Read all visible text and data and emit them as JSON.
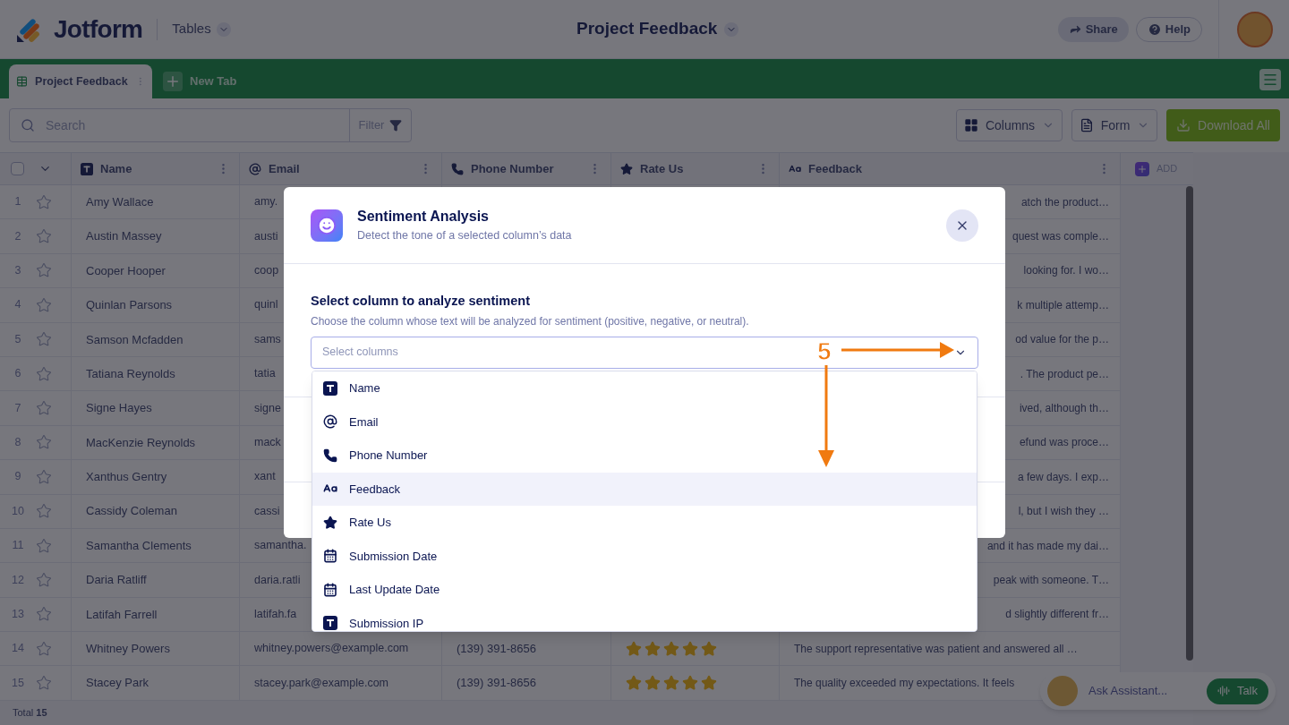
{
  "header": {
    "logo": "Jotform",
    "section": "Tables",
    "title": "Project Feedback",
    "share": "Share",
    "help": "Help"
  },
  "tabs": [
    {
      "label": "Project Feedback",
      "selected": true
    }
  ],
  "new_tab": "New Tab",
  "toolbar": {
    "search_placeholder": "Search",
    "filter": "Filter",
    "columns": "Columns",
    "form": "Form",
    "download": "Download All"
  },
  "table": {
    "columns": [
      {
        "label": "Name",
        "kind": "text"
      },
      {
        "label": "Email",
        "kind": "email"
      },
      {
        "label": "Phone Number",
        "kind": "phone"
      },
      {
        "label": "Rate Us",
        "kind": "rating"
      },
      {
        "label": "Feedback",
        "kind": "longtext"
      }
    ],
    "add": "ADD",
    "select_all_checked": false,
    "rows": [
      {
        "index": "1",
        "starred": false,
        "name": "Amy Wallace",
        "email": "amy.",
        "feedback": "atch the product…"
      },
      {
        "index": "2",
        "starred": false,
        "name": "Austin Massey",
        "email": "austi",
        "feedback": "quest was comple…"
      },
      {
        "index": "3",
        "starred": false,
        "name": "Cooper Hooper",
        "email": "coop",
        "feedback": "looking for. I wo…"
      },
      {
        "index": "4",
        "starred": false,
        "name": "Quinlan Parsons",
        "email": "quinl",
        "feedback": "k multiple attemp…"
      },
      {
        "index": "5",
        "starred": false,
        "name": "Samson Mcfadden",
        "email": "sams",
        "feedback": "od value for the p…"
      },
      {
        "index": "6",
        "starred": false,
        "name": "Tatiana Reynolds",
        "email": "tatia",
        "feedback": ". The product pe…"
      },
      {
        "index": "7",
        "starred": false,
        "name": "Signe Hayes",
        "email": "signe",
        "feedback": "ived, although th…"
      },
      {
        "index": "8",
        "starred": false,
        "name": "MacKenzie Reynolds",
        "email": "mack",
        "feedback": "efund was proce…"
      },
      {
        "index": "9",
        "starred": false,
        "name": "Xanthus Gentry",
        "email": "xant",
        "feedback": "a few days. I exp…"
      },
      {
        "index": "10",
        "starred": false,
        "name": "Cassidy Coleman",
        "email": "cassi",
        "feedback": "l, but I wish they …"
      },
      {
        "index": "11",
        "starred": false,
        "name": "Samantha Clements",
        "email": "samantha.",
        "feedback": "and it has made my dai…"
      },
      {
        "index": "12",
        "starred": false,
        "name": "Daria Ratliff",
        "email": "daria.ratli",
        "feedback": "peak with someone. T…"
      },
      {
        "index": "13",
        "starred": false,
        "name": "Latifah Farrell",
        "email": "latifah.fa",
        "feedback": "d slightly different fr…"
      },
      {
        "index": "14",
        "starred": false,
        "name": "Whitney Powers",
        "email": "whitney.powers@example.com",
        "phone": "(139) 391-8656",
        "stars": 5,
        "feedback": "The support representative was patient and answered all …"
      },
      {
        "index": "15",
        "starred": false,
        "name": "Stacey Park",
        "email": "stacey.park@example.com",
        "phone": "(139) 391-8656",
        "stars": 5,
        "feedback": "The quality exceeded my expectations. It feels"
      }
    ],
    "total": "Total **15**"
  },
  "modal": {
    "title": "Sentiment Analysis",
    "subtitle": "Detect the tone of a selected column’s data",
    "field_label": "Select column to analyze sentiment",
    "field_hint": "Choose the column whose text will be analyzed for sentiment (positive, negative, or neutral).",
    "placeholder": "Select columns",
    "options": [
      {
        "label": "Name",
        "kind": "text",
        "selected": false
      },
      {
        "label": "Email",
        "kind": "email",
        "selected": false
      },
      {
        "label": "Phone Number",
        "kind": "phone",
        "selected": false
      },
      {
        "label": "Feedback",
        "kind": "longtext",
        "selected": true
      },
      {
        "label": "Rate Us",
        "kind": "rating",
        "selected": false
      },
      {
        "label": "Submission Date",
        "kind": "date",
        "selected": false
      },
      {
        "label": "Last Update Date",
        "kind": "date",
        "selected": false
      },
      {
        "label": "Submission IP",
        "kind": "text",
        "selected": false
      }
    ]
  },
  "annotation": {
    "label": "5"
  },
  "assistant": {
    "placeholder": "Ask Assistant...",
    "talk": "Talk"
  }
}
